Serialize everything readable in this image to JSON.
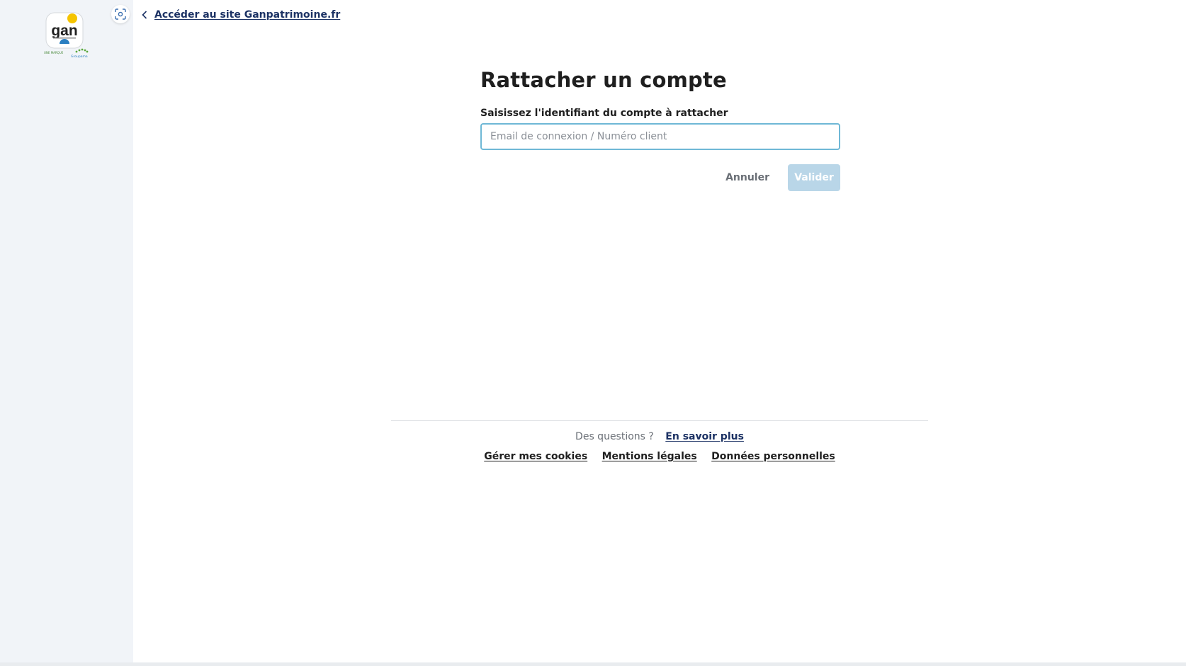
{
  "header": {
    "back_link_label": "Accéder au site Ganpatrimoine.fr",
    "back_icon": "chevron-left-icon",
    "screenshot_icon": "screenshot-capture-icon"
  },
  "brand": {
    "logo_text": "gan",
    "logo_subtext": "UNE MARQUE",
    "logo_group": "Groupama",
    "colors": {
      "accent_yellow": "#f5c400",
      "accent_blue": "#2a7fc1",
      "accent_green": "#5aa83c",
      "navy": "#1c3264"
    }
  },
  "form": {
    "title": "Rattacher un compte",
    "field_label": "Saisissez l'identifiant du compte à rattacher",
    "input_placeholder": "Email de connexion / Numéro client",
    "input_value": "",
    "cancel_label": "Annuler",
    "submit_label": "Valider"
  },
  "footer": {
    "question": "Des questions ?",
    "learn_more": "En savoir plus",
    "links": [
      "Gérer mes cookies",
      "Mentions légales",
      "Données personnelles"
    ]
  }
}
